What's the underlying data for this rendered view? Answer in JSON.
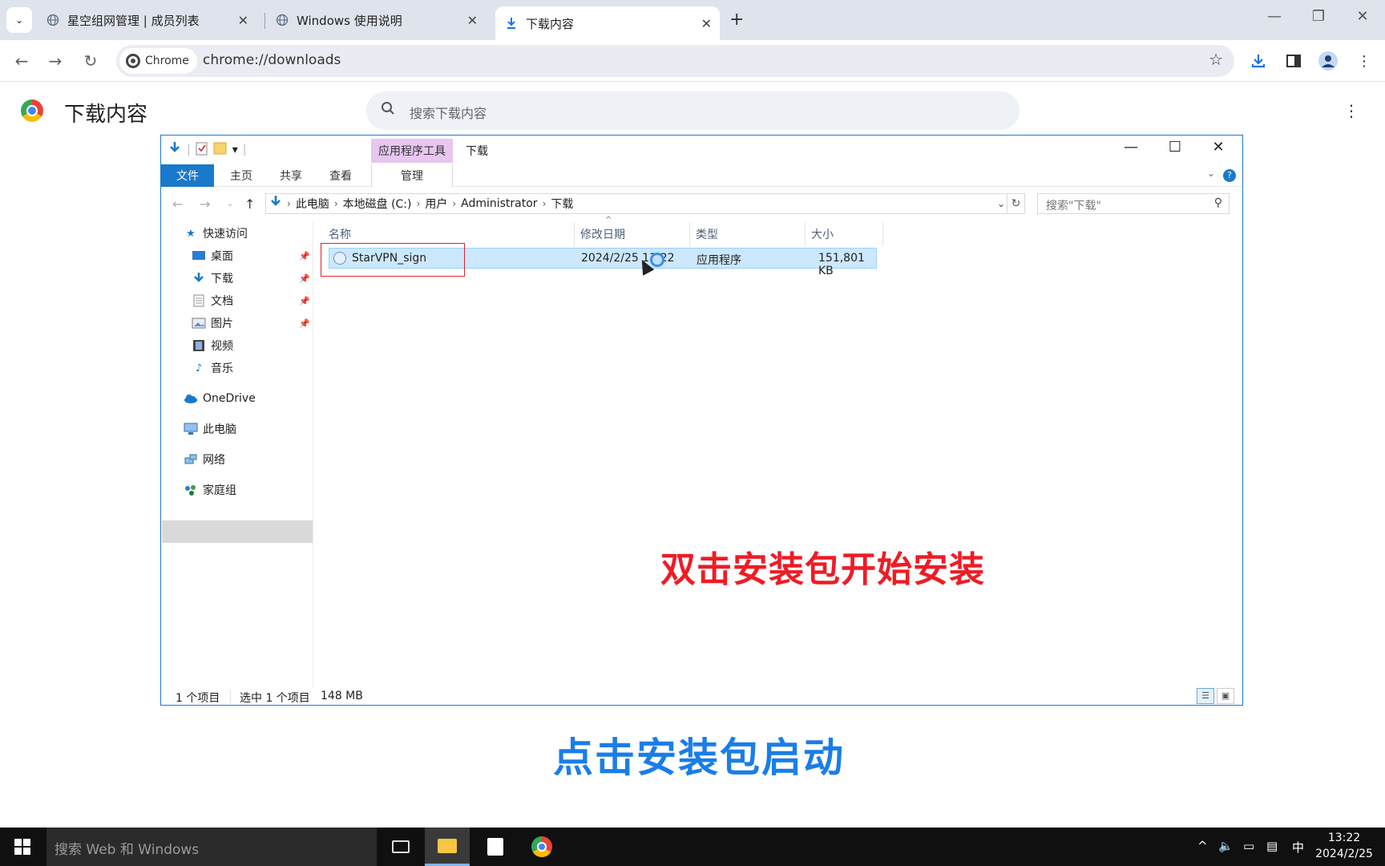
{
  "browser": {
    "tabs": [
      {
        "title": "星空组网管理 | 成员列表",
        "active": false
      },
      {
        "title": "Windows 使用说明",
        "active": false
      },
      {
        "title": "下载内容",
        "active": true
      }
    ],
    "new_tab_symbol": "+",
    "chip_label": "Chrome",
    "url": "chrome://downloads"
  },
  "downloads_page": {
    "title": "下载内容",
    "search_placeholder": "搜索下载内容"
  },
  "explorer": {
    "context_tab": "应用程序工具",
    "window_title": "下载",
    "ribbon_tabs": {
      "file": "文件",
      "home": "主页",
      "share": "共享",
      "view": "查看",
      "manage": "管理"
    },
    "breadcrumb": [
      "此电脑",
      "本地磁盘 (C:)",
      "用户",
      "Administrator",
      "下载"
    ],
    "search_placeholder": "搜索\"下载\"",
    "nav": {
      "quick_access": "快速访问",
      "desktop": "桌面",
      "downloads": "下载",
      "documents": "文档",
      "pictures": "图片",
      "videos": "视频",
      "music": "音乐",
      "onedrive": "OneDrive",
      "this_pc": "此电脑",
      "network": "网络",
      "homegroup": "家庭组"
    },
    "columns": {
      "name": "名称",
      "modified": "修改日期",
      "type": "类型",
      "size": "大小"
    },
    "files": [
      {
        "name": "StarVPN_sign",
        "modified": "2024/2/25 13:22",
        "type": "应用程序",
        "size": "151,801 KB"
      }
    ],
    "status": {
      "count": "1 个项目",
      "selected": "选中 1 个项目",
      "size": "148 MB"
    }
  },
  "annotations": {
    "instruction_red": "双击安装包开始安装",
    "caption_blue": "点击安装包启动"
  },
  "taskbar": {
    "search_placeholder": "搜索 Web 和 Windows",
    "ime": "中",
    "time": "13:22",
    "date": "2024/2/25"
  },
  "colors": {
    "accent_blue": "#1979ca",
    "annotation_red": "#ee1c25",
    "caption_blue": "#1a7de8",
    "selection": "#cce8ff"
  }
}
